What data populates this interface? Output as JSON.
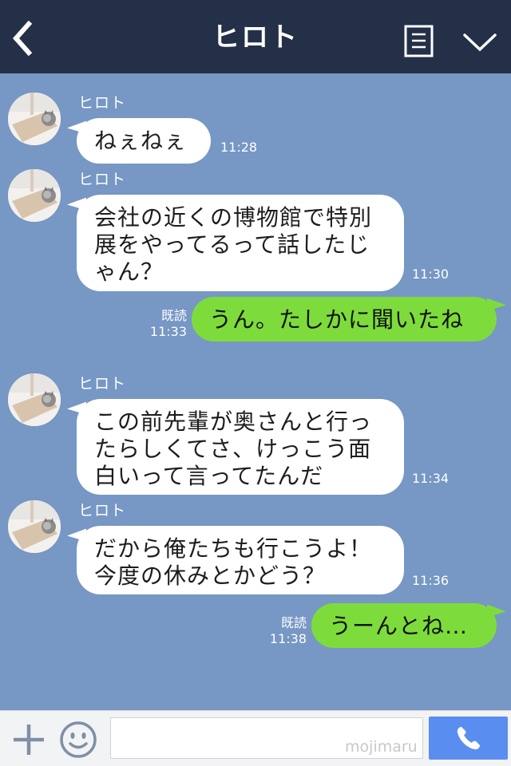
{
  "header": {
    "title": "ヒロト",
    "back_icon": "chevron-left-icon",
    "menu_icon": "list-icon",
    "expand_icon": "chevron-down-icon",
    "background": "#243047"
  },
  "chat": {
    "background": "#7797c4",
    "messages": [
      {
        "direction": "incoming",
        "sender": "ヒロト",
        "lines": [
          "ねぇねぇ"
        ],
        "time": "11:28"
      },
      {
        "direction": "incoming",
        "sender": "ヒロト",
        "lines": [
          "会社の近くの博物館で特別",
          "展をやってるって話したじ",
          "ゃん？"
        ],
        "time": "11:30"
      },
      {
        "direction": "outgoing",
        "read": "既読",
        "lines": [
          "うん。たしかに聞いたね"
        ],
        "time": "11:33"
      },
      {
        "direction": "incoming",
        "sender": "ヒロト",
        "lines": [
          "この前先輩が奥さんと行っ",
          "たらしくてさ、けっこう面",
          "白いって言ってたんだ"
        ],
        "time": "11:34"
      },
      {
        "direction": "incoming",
        "sender": "ヒロト",
        "lines": [
          "だから俺たちも行こうよ！",
          "今度の休みとかどう？"
        ],
        "time": "11:36"
      },
      {
        "direction": "outgoing",
        "read": "既読",
        "lines": [
          "うーんとね…"
        ],
        "time": "11:38"
      }
    ],
    "incoming_bubble_color": "#ffffff",
    "outgoing_bubble_color": "#7ddc3b"
  },
  "input_bar": {
    "plus_icon": "plus-icon",
    "emoji_icon": "smiley-icon",
    "placeholder": "",
    "watermark": "mojimaru",
    "call_icon": "phone-icon",
    "call_button_color": "#5a8df0"
  }
}
